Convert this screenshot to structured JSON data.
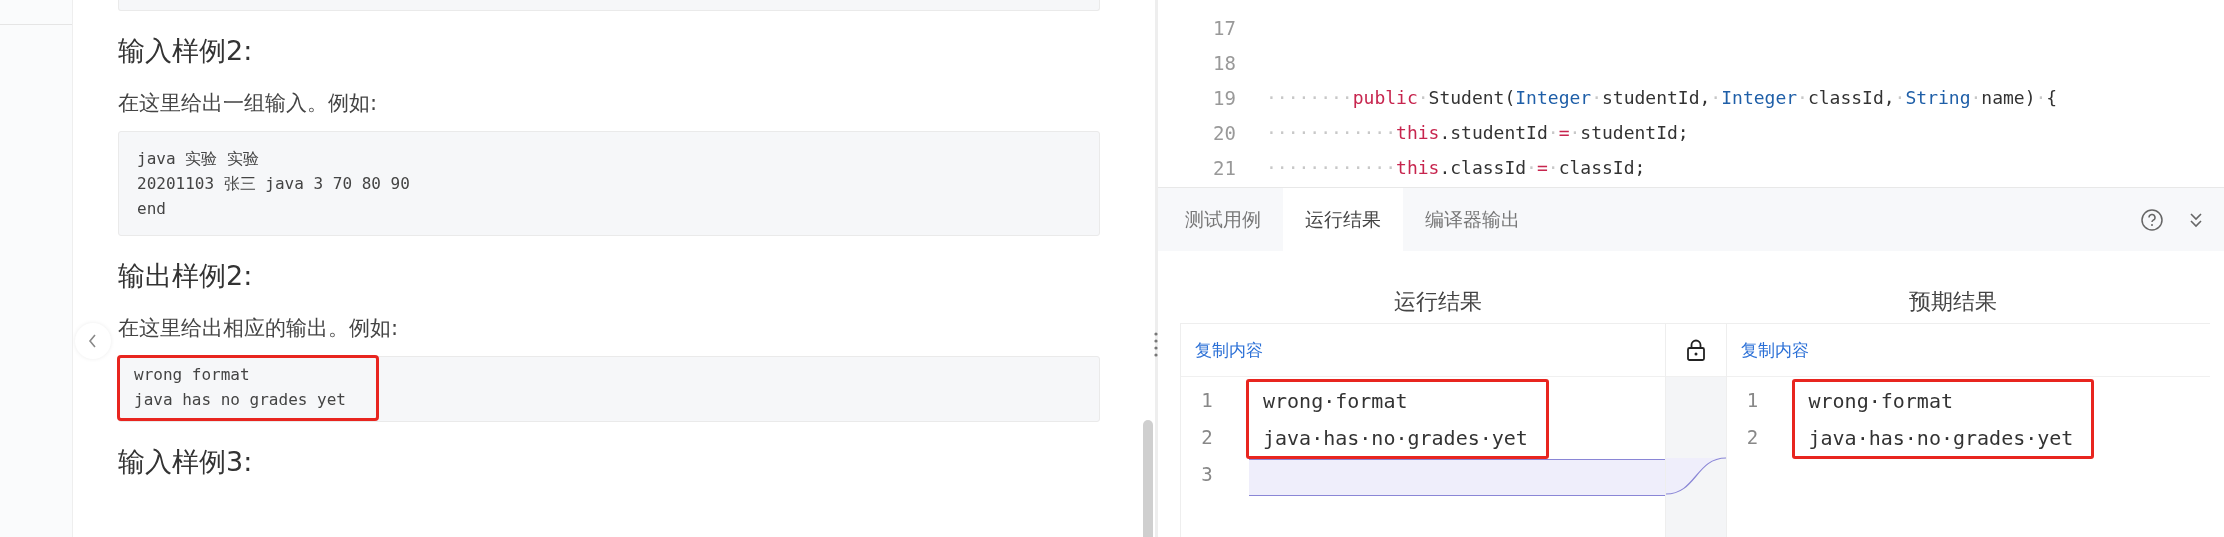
{
  "problem": {
    "sections": [
      {
        "kind": "code"
      },
      {
        "kind": "heading",
        "text": "输入样例2:"
      },
      {
        "kind": "paragraph",
        "text": "在这里给出一组输入。例如:"
      },
      {
        "kind": "code",
        "highlighted": false,
        "lines": [
          "java 实验 实验",
          "20201103 张三 java 3 70 80 90",
          "end"
        ]
      },
      {
        "kind": "heading",
        "text": "输出样例2:"
      },
      {
        "kind": "paragraph",
        "text": "在这里给出相应的输出。例如:"
      },
      {
        "kind": "code",
        "highlighted": true,
        "lines": [
          "wrong format",
          "java has no grades yet"
        ]
      },
      {
        "kind": "heading",
        "text": "输入样例3:"
      }
    ]
  },
  "editor": {
    "lines": [
      {
        "number": "17"
      },
      {
        "number": "18"
      },
      {
        "number": "19",
        "tokens": [
          {
            "kind": "ws",
            "text": "········"
          },
          {
            "kind": "keyword",
            "text": "public"
          },
          {
            "kind": "ws",
            "text": "·"
          },
          {
            "kind": "plain",
            "text": "Student("
          },
          {
            "kind": "type",
            "text": "Integer"
          },
          {
            "kind": "ws",
            "text": "·"
          },
          {
            "kind": "plain",
            "text": "studentId,"
          },
          {
            "kind": "ws",
            "text": "·"
          },
          {
            "kind": "type",
            "text": "Integer"
          },
          {
            "kind": "ws",
            "text": "·"
          },
          {
            "kind": "plain",
            "text": "classId,"
          },
          {
            "kind": "ws",
            "text": "·"
          },
          {
            "kind": "type",
            "text": "String"
          },
          {
            "kind": "ws",
            "text": "·"
          },
          {
            "kind": "plain",
            "text": "name)"
          },
          {
            "kind": "ws",
            "text": "·"
          },
          {
            "kind": "plain",
            "text": "{"
          }
        ]
      },
      {
        "number": "20",
        "tokens": [
          {
            "kind": "ws",
            "text": "············"
          },
          {
            "kind": "keyword",
            "text": "this"
          },
          {
            "kind": "plain",
            "text": ".studentId"
          },
          {
            "kind": "ws",
            "text": "·"
          },
          {
            "kind": "keyword",
            "text": "="
          },
          {
            "kind": "ws",
            "text": "·"
          },
          {
            "kind": "plain",
            "text": "studentId;"
          }
        ]
      },
      {
        "number": "21",
        "tokens": [
          {
            "kind": "ws",
            "text": "············"
          },
          {
            "kind": "keyword",
            "text": "this"
          },
          {
            "kind": "plain",
            "text": ".classId"
          },
          {
            "kind": "ws",
            "text": "·"
          },
          {
            "kind": "keyword",
            "text": "="
          },
          {
            "kind": "ws",
            "text": "·"
          },
          {
            "kind": "plain",
            "text": "classId;"
          }
        ]
      }
    ]
  },
  "tabs": [
    {
      "label": "测试用例",
      "selected": false
    },
    {
      "label": "运行结果",
      "selected": true
    },
    {
      "label": "编译器输出",
      "selected": false
    }
  ],
  "results": [
    {
      "title": "运行结果",
      "copy_label": "复制内容",
      "lines": [
        {
          "number": "1",
          "text": "wrong·format",
          "highlighted": true,
          "diff": false
        },
        {
          "number": "2",
          "text": "java·has·no·grades·yet",
          "highlighted": true,
          "diff": false
        },
        {
          "number": "3",
          "highlighted": false,
          "diff": true
        }
      ]
    },
    {
      "title": "预期结果",
      "copy_label": "复制内容",
      "lines": [
        {
          "number": "1",
          "text": "wrong·format",
          "highlighted": true,
          "diff": false
        },
        {
          "number": "2",
          "text": "java·has·no·grades·yet",
          "highlighted": true,
          "diff": false
        }
      ]
    }
  ]
}
